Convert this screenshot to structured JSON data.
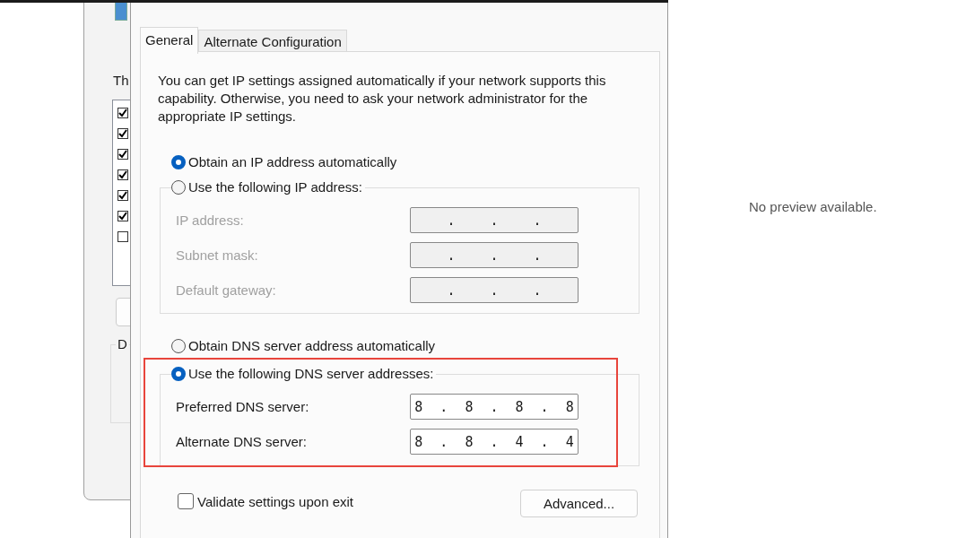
{
  "background_window": {
    "heading": "Th",
    "items": [
      {
        "checked": true
      },
      {
        "checked": true
      },
      {
        "checked": true
      },
      {
        "checked": true
      },
      {
        "checked": true
      },
      {
        "checked": true
      },
      {
        "checked": false
      }
    ],
    "group_label": "D"
  },
  "dialog": {
    "tabs": [
      {
        "label": "General",
        "selected": true
      },
      {
        "label": "Alternate Configuration",
        "selected": false
      }
    ],
    "description": "You can get IP settings assigned automatically if your network supports this capability. Otherwise, you need to ask your network administrator for the appropriate IP settings.",
    "ip_options": [
      {
        "label": "Obtain an IP address automatically",
        "selected": true
      },
      {
        "label": "Use the following IP address:",
        "selected": false
      }
    ],
    "ip_group": {
      "disabled": true,
      "fields": [
        {
          "label": "IP address:",
          "value": ". . ."
        },
        {
          "label": "Subnet mask:",
          "value": ". . ."
        },
        {
          "label": "Default gateway:",
          "value": ". . ."
        }
      ]
    },
    "dns_options": [
      {
        "label": "Obtain DNS server address automatically",
        "selected": false
      },
      {
        "label": "Use the following DNS server addresses:",
        "selected": true
      }
    ],
    "dns_group": {
      "disabled": false,
      "highlighted": true,
      "fields": [
        {
          "label": "Preferred DNS server:",
          "value": "8 . 8 . 8 . 8"
        },
        {
          "label": "Alternate DNS server:",
          "value": "8 . 8 . 4 . 4"
        }
      ]
    },
    "validate": {
      "label": "Validate settings upon exit",
      "checked": false
    },
    "advanced_button": "Advanced..."
  },
  "preview": {
    "message": "No preview available."
  }
}
